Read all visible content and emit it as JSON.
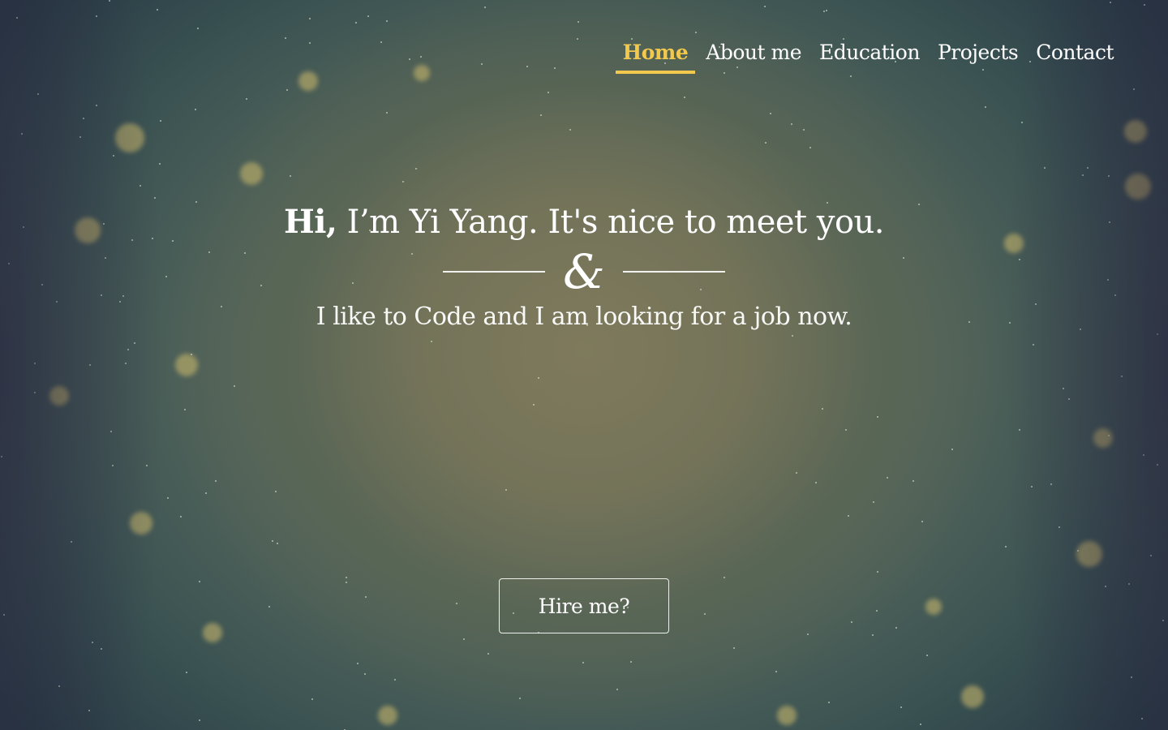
{
  "nav": {
    "items": [
      {
        "label": "Home",
        "active": true
      },
      {
        "label": "About me",
        "active": false
      },
      {
        "label": "Education",
        "active": false
      },
      {
        "label": "Projects",
        "active": false
      },
      {
        "label": "Contact",
        "active": false
      }
    ],
    "active_color": "#f2c94c"
  },
  "hero": {
    "greeting_bold": "Hi,",
    "greeting_rest": " I’m Yi Yang. It's nice to meet you.",
    "ampersand": "&",
    "tagline": "I like to Code and I am looking for a job now.",
    "cta_label": "Hire me?"
  }
}
